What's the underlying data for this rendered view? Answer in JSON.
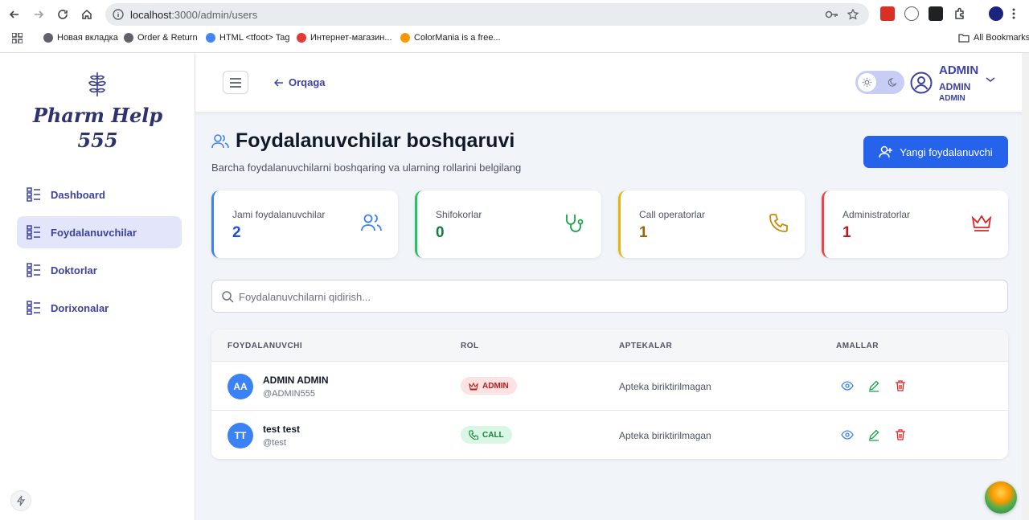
{
  "browser": {
    "url_host": "localhost",
    "url_path": ":3000/admin/users",
    "bookmarks": [
      "Новая вкладка",
      "Order & Return",
      "HTML <tfoot> Tag",
      "Интернет-магазин...",
      "ColorMania is a free..."
    ],
    "all_bookmarks": "All Bookmarks"
  },
  "sidebar": {
    "logo_line1": "Pharm Help",
    "logo_line2": "555",
    "items": [
      {
        "label": "Dashboard",
        "active": false
      },
      {
        "label": "Foydalanuvchilar",
        "active": true
      },
      {
        "label": "Doktorlar",
        "active": false
      },
      {
        "label": "Dorixonalar",
        "active": false
      }
    ]
  },
  "topbar": {
    "back_label": "Orqaga",
    "user_name": "ADMIN",
    "user_sub1": "ADMIN",
    "user_sub2": "ADMIN"
  },
  "page": {
    "title": "Foydalanuvchilar boshqaruvi",
    "subtitle": "Barcha foydalanuvchilarni boshqaring va ularning rollarini belgilang",
    "new_button": "Yangi foydalanuvchi"
  },
  "stats": [
    {
      "label": "Jami foydalanuvchilar",
      "value": "2",
      "color": "#3b82f6",
      "icon": "users-icon"
    },
    {
      "label": "Shifokorlar",
      "value": "0",
      "color": "#16a34a",
      "icon": "stethoscope-icon"
    },
    {
      "label": "Call operatorlar",
      "value": "1",
      "color": "#ca8a04",
      "icon": "phone-icon"
    },
    {
      "label": "Administratorlar",
      "value": "1",
      "color": "#dc2626",
      "icon": "crown-icon"
    }
  ],
  "search": {
    "placeholder": "Foydalanuvchilarni qidirish..."
  },
  "table": {
    "headers": [
      "FOYDALANUVCHI",
      "ROL",
      "APTEKALAR",
      "AMALLAR"
    ],
    "rows": [
      {
        "initials": "AA",
        "name": "ADMIN ADMIN",
        "handle": "@ADMIN555",
        "role": "ADMIN",
        "pharmacy": "Apteka biriktirilmagan"
      },
      {
        "initials": "TT",
        "name": "test test",
        "handle": "@test",
        "role": "CALL",
        "pharmacy": "Apteka biriktirilmagan"
      }
    ]
  }
}
